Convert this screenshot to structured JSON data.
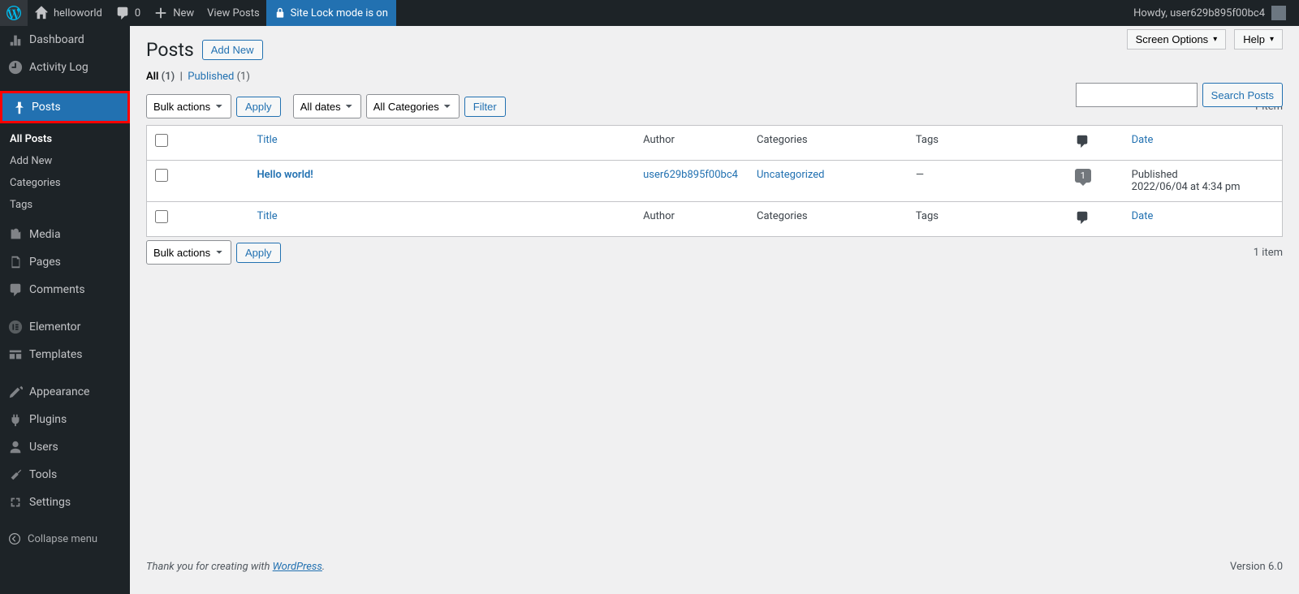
{
  "topbar": {
    "site_name": "helloworld",
    "comments_count": "0",
    "new_label": "New",
    "view_posts_label": "View Posts",
    "sitelock_label": "Site Lock mode is on",
    "howdy_prefix": "Howdy, ",
    "username": "user629b895f00bc4"
  },
  "sidebar": {
    "dashboard": "Dashboard",
    "activity_log": "Activity Log",
    "posts": "Posts",
    "posts_sub": {
      "all_posts": "All Posts",
      "add_new": "Add New",
      "categories": "Categories",
      "tags": "Tags"
    },
    "media": "Media",
    "pages": "Pages",
    "comments": "Comments",
    "elementor": "Elementor",
    "templates": "Templates",
    "appearance": "Appearance",
    "plugins": "Plugins",
    "users": "Users",
    "tools": "Tools",
    "settings": "Settings",
    "collapse": "Collapse menu"
  },
  "actions": {
    "screen_options": "Screen Options",
    "help": "Help"
  },
  "page": {
    "title": "Posts",
    "add_new": "Add New"
  },
  "views": {
    "all_label": "All",
    "all_count": "(1)",
    "sep": "|",
    "published_label": "Published",
    "published_count": "(1)"
  },
  "search": {
    "button": "Search Posts"
  },
  "filters": {
    "bulk": "Bulk actions",
    "apply": "Apply",
    "dates": "All dates",
    "categories": "All Categories",
    "filter": "Filter"
  },
  "pagination": {
    "count": "1 item"
  },
  "columns": {
    "title": "Title",
    "author": "Author",
    "categories": "Categories",
    "tags": "Tags",
    "date": "Date"
  },
  "rows": [
    {
      "title": "Hello world!",
      "author": "user629b895f00bc4",
      "category": "Uncategorized",
      "tags": "—",
      "comments": "1",
      "date_status": "Published",
      "date_value": "2022/06/04 at 4:34 pm"
    }
  ],
  "footer": {
    "thanks_prefix": "Thank you for creating with ",
    "wp": "WordPress",
    "dot": ".",
    "version": "Version 6.0"
  }
}
